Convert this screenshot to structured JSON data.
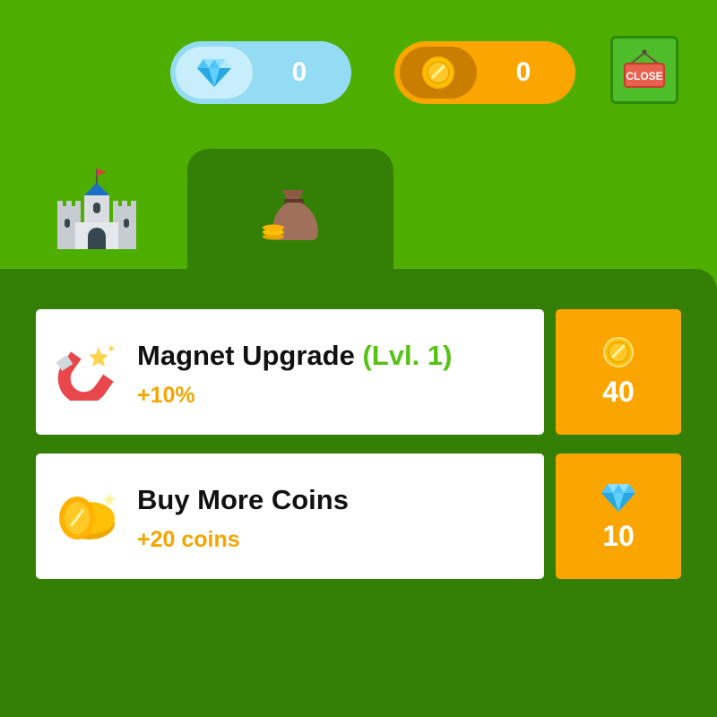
{
  "currency": {
    "gems": {
      "icon": "gem-icon",
      "value": "0",
      "color": "#94dcf4"
    },
    "coins": {
      "icon": "coin-icon",
      "value": "0",
      "color": "#fba600"
    }
  },
  "close_button": {
    "label": "CLOSE",
    "icon": "close-sign-icon"
  },
  "tabs": [
    {
      "name": "castle",
      "icon": "castle-icon",
      "selected": false
    },
    {
      "name": "shop",
      "icon": "money-bag-icon",
      "selected": true
    }
  ],
  "shop_items": [
    {
      "icon": "magnet-icon",
      "title": "Magnet Upgrade",
      "level": "(Lvl. 1)",
      "subtitle": "+10%",
      "price": "40",
      "price_icon": "coin-icon"
    },
    {
      "icon": "coin-stack-icon",
      "title": "Buy More Coins",
      "subtitle": "+20 coins",
      "price": "10",
      "price_icon": "gem-icon"
    }
  ],
  "colors": {
    "background": "#4eae00",
    "panel": "#347f05",
    "accent_orange": "#fba600",
    "level_green": "#55c214"
  }
}
